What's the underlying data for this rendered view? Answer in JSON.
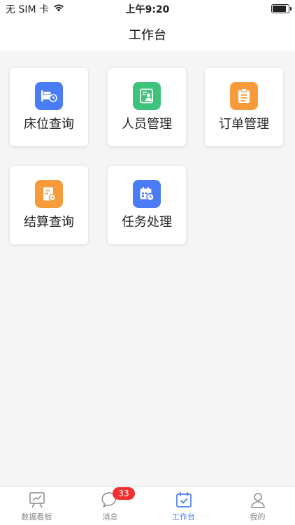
{
  "status_bar": {
    "carrier": "无 SIM 卡",
    "time": "上午9:20",
    "battery_level": 0.8
  },
  "header": {
    "title": "工作台"
  },
  "colors": {
    "blue": "#4a7cf7",
    "green": "#3ec47a",
    "orange": "#f79a3a",
    "accent": "#4a7cf7"
  },
  "tiles": [
    {
      "label": "床位查询",
      "icon": "bed-icon",
      "color": "#4a7cf7"
    },
    {
      "label": "人员管理",
      "icon": "person-card-icon",
      "color": "#3ec47a"
    },
    {
      "label": "订单管理",
      "icon": "clipboard-icon",
      "color": "#f79a3a"
    },
    {
      "label": "结算查询",
      "icon": "receipt-icon",
      "color": "#f79a3a"
    },
    {
      "label": "任务处理",
      "icon": "calendar-clock-icon",
      "color": "#4a7cf7"
    }
  ],
  "tabbar": {
    "items": [
      {
        "label": "数据看板",
        "icon": "board-icon",
        "active": false
      },
      {
        "label": "消息",
        "icon": "chat-icon",
        "active": false,
        "badge": "33"
      },
      {
        "label": "工作台",
        "icon": "calendar-check-icon",
        "active": true
      },
      {
        "label": "我的",
        "icon": "user-icon",
        "active": false
      }
    ]
  }
}
